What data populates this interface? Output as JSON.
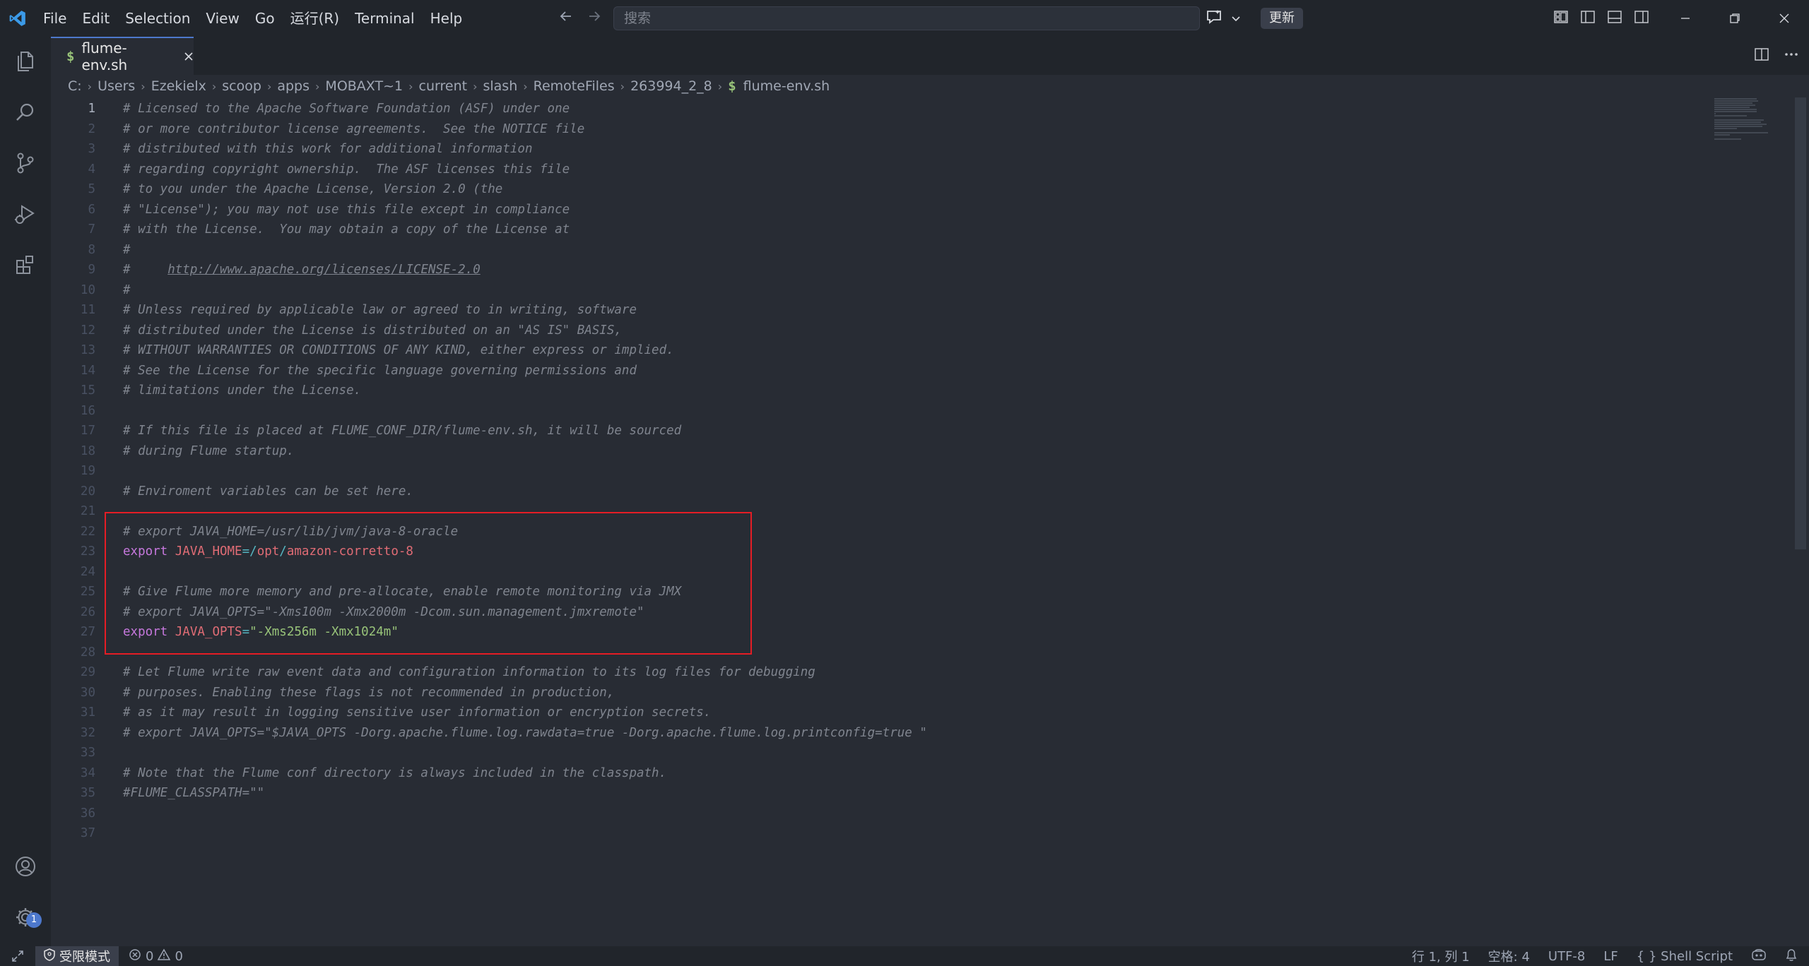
{
  "titlebar": {
    "menu": [
      "File",
      "Edit",
      "Selection",
      "View",
      "Go",
      "运行(R)",
      "Terminal",
      "Help"
    ],
    "search_placeholder": "搜索",
    "update_label": "更新"
  },
  "activity": {
    "settings_badge": "1"
  },
  "tab": {
    "icon": "$",
    "label": "flume-env.sh"
  },
  "breadcrumb": {
    "parts": [
      "C:",
      "Users",
      "Ezekielx",
      "scoop",
      "apps",
      "MOBAXT~1",
      "current",
      "slash",
      "RemoteFiles",
      "263994_2_8"
    ],
    "file_icon": "$",
    "file": "flume-env.sh"
  },
  "editor": {
    "active_line": 1,
    "line_numbers": [
      "1",
      "2",
      "3",
      "4",
      "5",
      "6",
      "7",
      "8",
      "9",
      "10",
      "11",
      "12",
      "13",
      "14",
      "15",
      "16",
      "17",
      "18",
      "19",
      "20",
      "21",
      "22",
      "23",
      "24",
      "25",
      "26",
      "27",
      "28",
      "29",
      "30",
      "31",
      "32",
      "33",
      "34",
      "35",
      "36",
      "37"
    ],
    "lines": [
      [
        {
          "t": "# Licensed to the Apache Software Foundation (ASF) under one",
          "c": "cm"
        }
      ],
      [
        {
          "t": "# or more contributor license agreements.  See the NOTICE file",
          "c": "cm"
        }
      ],
      [
        {
          "t": "# distributed with this work for additional information",
          "c": "cm"
        }
      ],
      [
        {
          "t": "# regarding copyright ownership.  The ASF licenses this file",
          "c": "cm"
        }
      ],
      [
        {
          "t": "# to you under the Apache License, Version 2.0 (the",
          "c": "cm"
        }
      ],
      [
        {
          "t": "# \"License\"); you may not use this file except in compliance",
          "c": "cm"
        }
      ],
      [
        {
          "t": "# with the License.  You may obtain a copy of the License at",
          "c": "cm"
        }
      ],
      [
        {
          "t": "#",
          "c": "cm"
        }
      ],
      [
        {
          "t": "#     ",
          "c": "cm"
        },
        {
          "t": "http://www.apache.org/licenses/LICENSE-2.0",
          "c": "cm url"
        }
      ],
      [
        {
          "t": "#",
          "c": "cm"
        }
      ],
      [
        {
          "t": "# Unless required by applicable law or agreed to in writing, software",
          "c": "cm"
        }
      ],
      [
        {
          "t": "# distributed under the License is distributed on an \"AS IS\" BASIS,",
          "c": "cm"
        }
      ],
      [
        {
          "t": "# WITHOUT WARRANTIES OR CONDITIONS OF ANY KIND, either express or implied.",
          "c": "cm"
        }
      ],
      [
        {
          "t": "# See the License for the specific language governing permissions and",
          "c": "cm"
        }
      ],
      [
        {
          "t": "# limitations under the License.",
          "c": "cm"
        }
      ],
      [],
      [
        {
          "t": "# If this file is placed at FLUME_CONF_DIR/flume-env.sh, it will be sourced",
          "c": "cm"
        }
      ],
      [
        {
          "t": "# during Flume startup.",
          "c": "cm"
        }
      ],
      [],
      [
        {
          "t": "# Enviroment variables can be set here.",
          "c": "cm"
        }
      ],
      [],
      [
        {
          "t": "# export JAVA_HOME=/usr/lib/jvm/java-8-oracle",
          "c": "cm"
        }
      ],
      [
        {
          "t": "export",
          "c": "kw"
        },
        {
          "t": " ",
          "c": ""
        },
        {
          "t": "JAVA_HOME",
          "c": "var"
        },
        {
          "t": "=",
          "c": "op"
        },
        {
          "t": "/",
          "c": "op"
        },
        {
          "t": "opt",
          "c": "var"
        },
        {
          "t": "/",
          "c": "op"
        },
        {
          "t": "amazon-corretto-8",
          "c": "var"
        }
      ],
      [],
      [
        {
          "t": "# Give Flume more memory and pre-allocate, enable remote monitoring via JMX",
          "c": "cm"
        }
      ],
      [
        {
          "t": "# export JAVA_OPTS=\"-Xms100m -Xmx2000m -Dcom.sun.management.jmxremote\"",
          "c": "cm"
        }
      ],
      [
        {
          "t": "export",
          "c": "kw"
        },
        {
          "t": " ",
          "c": ""
        },
        {
          "t": "JAVA_OPTS",
          "c": "var"
        },
        {
          "t": "=",
          "c": "op"
        },
        {
          "t": "\"-Xms256m -Xmx1024m\"",
          "c": "str"
        }
      ],
      [],
      [
        {
          "t": "# Let Flume write raw event data and configuration information to its log files for debugging",
          "c": "cm"
        }
      ],
      [
        {
          "t": "# purposes. Enabling these flags is not recommended in production,",
          "c": "cm"
        }
      ],
      [
        {
          "t": "# as it may result in logging sensitive user information or encryption secrets.",
          "c": "cm"
        }
      ],
      [
        {
          "t": "# export JAVA_OPTS=\"$JAVA_OPTS -Dorg.apache.flume.log.rawdata=true -Dorg.apache.flume.log.printconfig=true \"",
          "c": "cm"
        }
      ],
      [],
      [
        {
          "t": "# Note that the Flume conf directory is always included in the classpath.",
          "c": "cm"
        }
      ],
      [
        {
          "t": "#FLUME_CLASSPATH=\"\"",
          "c": "cm"
        }
      ],
      [],
      []
    ]
  },
  "statusbar": {
    "restricted_mode": "受限模式",
    "errors": "0",
    "warnings": "0",
    "cursor": "行 1, 列 1",
    "indent": "空格: 4",
    "encoding": "UTF-8",
    "eol": "LF",
    "language_braces": "{ }",
    "language": "Shell Script"
  },
  "colors": {
    "accent": "#4d78cc",
    "highlight_box": "#e51d25",
    "comment": "#7f848e",
    "keyword": "#c678dd",
    "variable": "#e06c75",
    "string": "#98c379"
  }
}
